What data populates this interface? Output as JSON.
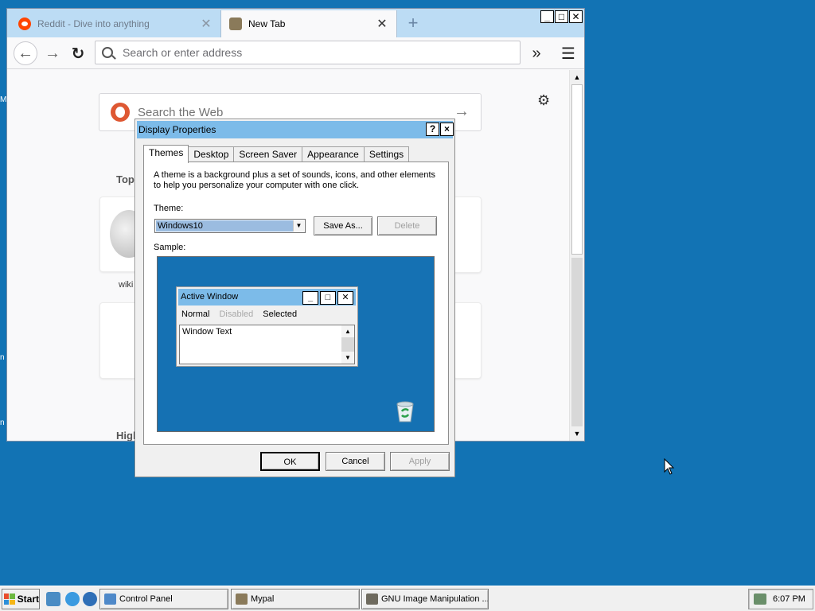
{
  "browser": {
    "tabs": [
      {
        "label": "Reddit - Dive into anything",
        "active": false,
        "favicon": "reddit-icon"
      },
      {
        "label": "New Tab",
        "active": true,
        "favicon": "newtab-icon"
      }
    ],
    "new_tab_glyph": "+",
    "url_placeholder": "Search or enter address",
    "web_search_placeholder": "Search the Web",
    "section_top": "Top",
    "section_highlights": "High",
    "tile_label": "wiki"
  },
  "dialog": {
    "title": "Display Properties",
    "help_glyph": "?",
    "close_glyph": "×",
    "tabs": [
      "Themes",
      "Desktop",
      "Screen Saver",
      "Appearance",
      "Settings"
    ],
    "active_tab": "Themes",
    "description": "A theme is a background plus a set of sounds, icons, and other elements to help you personalize your computer with one click.",
    "theme_label": "Theme:",
    "theme_value": "Windows10",
    "save_as_label": "Save As...",
    "delete_label": "Delete",
    "sample_label": "Sample:",
    "sample": {
      "window_title": "Active Window",
      "menu_normal": "Normal",
      "menu_disabled": "Disabled",
      "menu_selected": "Selected",
      "window_text": "Window Text"
    },
    "ok_label": "OK",
    "cancel_label": "Cancel",
    "apply_label": "Apply"
  },
  "taskbar": {
    "start_label": "Start",
    "tasks": [
      "Control Panel",
      "Mypal",
      "GNU Image Manipulation ..."
    ],
    "clock": "6:07 PM"
  },
  "colors": {
    "desktop": "#1273b4",
    "title_bar": "#7cbbe9",
    "tab_strip": "#bcdcf4"
  }
}
